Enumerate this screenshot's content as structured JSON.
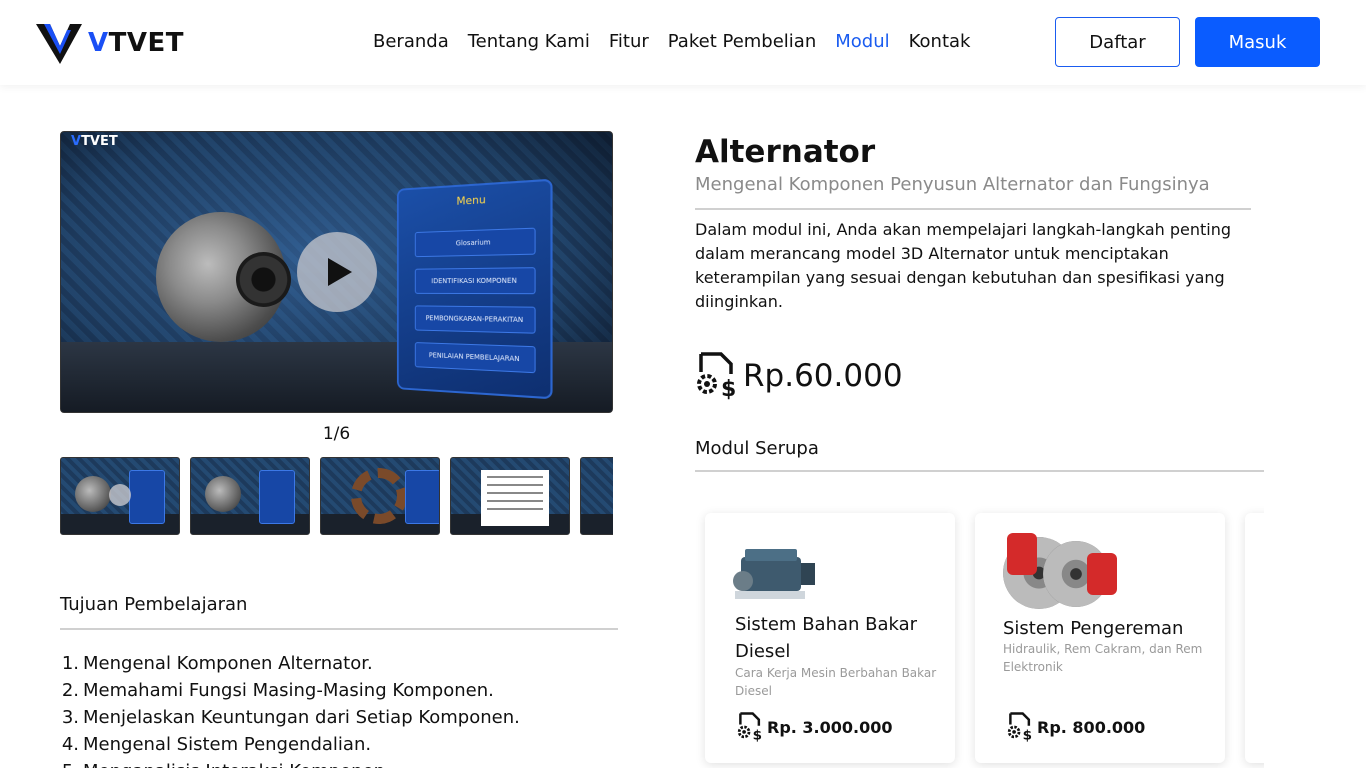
{
  "header": {
    "logo_text_v": "V",
    "logo_text_rest": "TVET",
    "nav": [
      "Beranda",
      "Tentang Kami",
      "Fitur",
      "Paket Pembelian",
      "Modul",
      "Kontak"
    ],
    "active_nav": "Modul",
    "daftar_label": "Daftar",
    "masuk_label": "Masuk",
    "accent_color": "#0a5cff"
  },
  "media": {
    "logo_v": "V",
    "logo_rest": "TVET",
    "menu_title": "Menu",
    "menu_items": [
      "Glosarium",
      "IDENTIFIKASI KOMPONEN",
      "PEMBONGKARAN-PERAKITAN",
      "PENILAIAN PEMBELAJARAN"
    ],
    "pager": "1/6",
    "thumbnail_count": 5
  },
  "tujuan": {
    "title": "Tujuan Pembelajaran",
    "items": [
      "Mengenal Komponen Alternator.",
      "Memahami Fungsi Masing-Masing Komponen.",
      "Menjelaskan Keuntungan dari Setiap Komponen.",
      "Mengenal Sistem Pengendalian.",
      "Menganalisis Interaksi Komponen"
    ]
  },
  "module": {
    "title": "Alternator",
    "subtitle": "Mengenal Komponen Penyusun Alternator dan Fungsinya",
    "description": "Dalam modul ini, Anda akan mempelajari langkah-langkah penting dalam merancang model 3D Alternator untuk menciptakan keterampilan yang sesuai dengan kebutuhan dan spesifikasi yang diinginkan.",
    "price": "Rp.60.000",
    "price_icon": "gear-dollar-icon"
  },
  "serupa": {
    "title": "Modul Serupa",
    "cards": [
      {
        "name": "Sistem Bahan Bakar Diesel",
        "desc": "Cara Kerja Mesin Berbahan Bakar Diesel",
        "price": "Rp. 3.000.000",
        "image": "diesel-engine"
      },
      {
        "name": "Sistem Pengereman",
        "desc": "Hidraulik, Rem Cakram, dan Rem Elektronik",
        "price": "Rp. 800.000",
        "image": "brake-disc"
      }
    ]
  }
}
